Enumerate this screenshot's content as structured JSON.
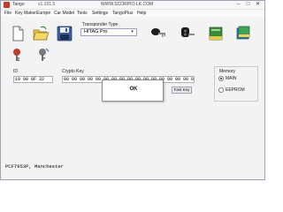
{
  "window": {
    "app_name": "Tango",
    "version": "v1.101.5",
    "site": "WWW.SCORPIO-LK.COM",
    "minimize": "–",
    "maximize": "□",
    "close": "✕"
  },
  "menu": {
    "items": [
      "File",
      "Key Maker",
      "Europe",
      "Car Model",
      "Tools",
      "Settings",
      "TangoPlus",
      "Help"
    ]
  },
  "toolbar": {
    "buttons": [
      "new-document-icon",
      "open-folder-icon",
      "save-disk-icon"
    ],
    "transponder_type_label": "Transponder Type",
    "transponder_type_value": "HITAG Pro",
    "key_icons": [
      "car-key-icon",
      "remote-key-icon",
      "book-icon",
      "book-stack-icon"
    ]
  },
  "key_rows": {
    "icons": [
      "key-read-icon",
      "key-write-icon"
    ]
  },
  "id_group": {
    "label": "ID",
    "value": "19 90 8F 32"
  },
  "crypto_group": {
    "label": "Crypto Key",
    "value": "00 00 00 00 00 00 00 00 00 00 00 00 00 00 00 00 00 00 00 00 00 00 00 00",
    "button": "Fast Key"
  },
  "memory_group": {
    "label": "Memory",
    "options": [
      "MAIN",
      "EEPROM"
    ],
    "selected": "MAIN"
  },
  "dialog": {
    "text": "OK"
  },
  "status": {
    "text": "PCF7953P, Manchester"
  },
  "colors": {
    "accent": "#3a7bd5",
    "window_bg": "#f3f3f3"
  }
}
